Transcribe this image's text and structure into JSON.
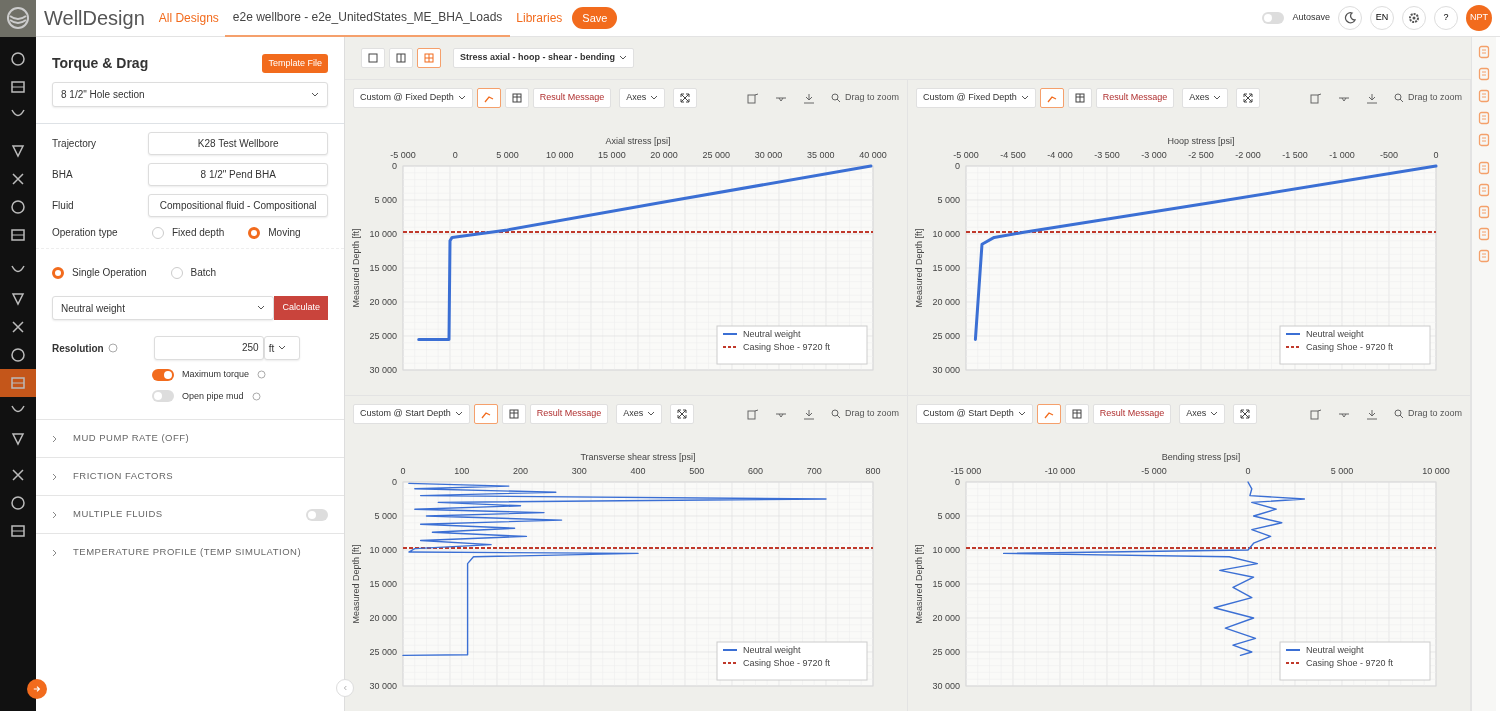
{
  "app": {
    "name": "WellDesign",
    "nav": [
      {
        "label": "All Designs",
        "kind": "link",
        "selected": false
      },
      {
        "label": "e2e wellbore - e2e_UnitedStates_ME_BHA_Loads",
        "kind": "tab",
        "selected": true
      },
      {
        "label": "Libraries",
        "kind": "link",
        "selected": false
      }
    ],
    "save": "Save",
    "autosave": {
      "label": "Autosave",
      "on": false
    },
    "language": "EN",
    "help": "?",
    "avatar": "NPT"
  },
  "sidebar": {
    "items": [
      {
        "selected": false
      },
      {
        "selected": false
      },
      {
        "selected": false
      },
      {
        "selected": false
      },
      {
        "selected": false
      },
      {
        "selected": false
      },
      {
        "selected": false
      },
      {
        "selected": false
      },
      {
        "selected": false
      },
      {
        "selected": false
      },
      {
        "selected": false
      },
      {
        "selected": true
      },
      {
        "selected": false
      },
      {
        "selected": false
      },
      {
        "selected": false
      },
      {
        "selected": false
      },
      {
        "selected": false
      }
    ]
  },
  "panel": {
    "title": "Torque & Drag",
    "template_button": "Template File",
    "section": "8 1/2\" Hole section",
    "fields": [
      {
        "label": "Trajectory",
        "value": "K28 Test Wellbore"
      },
      {
        "label": "BHA",
        "value": "8 1/2\" Pend BHA"
      },
      {
        "label": "Fluid",
        "value": "Compositional fluid - Compositional"
      }
    ],
    "operation_type": {
      "label": "Operation type",
      "options": [
        {
          "label": "Fixed depth",
          "selected": false
        },
        {
          "label": "Moving",
          "selected": true
        }
      ]
    },
    "mode": [
      {
        "label": "Single Operation",
        "selected": true
      },
      {
        "label": "Batch",
        "selected": false
      }
    ],
    "operation": "Neutral weight",
    "calculate": "Calculate",
    "resolution": {
      "label": "Resolution",
      "value": "250",
      "unit": "ft"
    },
    "toggles": [
      {
        "label": "Maximum torque",
        "on": true
      },
      {
        "label": "Open pipe mud",
        "on": false
      }
    ],
    "sections": [
      {
        "label": "MUD PUMP RATE (OFF)"
      },
      {
        "label": "FRICTION FACTORS"
      },
      {
        "label": "MULTIPLE FLUIDS",
        "on": false
      },
      {
        "label": "TEMPERATURE PROFILE (TEMP SIMULATION)"
      }
    ]
  },
  "workspace": {
    "layouts": [
      {
        "selected": false
      },
      {
        "selected": false
      },
      {
        "selected": true
      }
    ],
    "view_select": "Stress axial - hoop - shear - bending",
    "charts": [
      {
        "mode": "Custom @ Fixed Depth",
        "views": [
          {
            "selected": true
          },
          {
            "selected": false
          }
        ],
        "result": "Result Message",
        "axes": "Axes",
        "zoom": "Drag to zoom",
        "chart_data": {
          "type": "line",
          "grid": true,
          "legend": true,
          "xlabel": "Axial stress [psi]",
          "ylabel": "Measured Depth [ft]",
          "xlim": [
            -5000,
            40000
          ],
          "ylim": [
            30000,
            0
          ],
          "xticks": [
            {
              "value": -5000,
              "label": "-5 000"
            },
            {
              "value": 0,
              "label": "0"
            },
            {
              "value": 5000,
              "label": "5 000"
            },
            {
              "value": 10000,
              "label": "10 000"
            },
            {
              "value": 15000,
              "label": "15 000"
            },
            {
              "value": 20000,
              "label": "20 000"
            },
            {
              "value": 25000,
              "label": "25 000"
            },
            {
              "value": 30000,
              "label": "30 000"
            },
            {
              "value": 35000,
              "label": "35 000"
            },
            {
              "value": 40000,
              "label": "40 000"
            }
          ],
          "yticks": [
            {
              "value": 0,
              "label": "0"
            },
            {
              "value": 5000,
              "label": "5 000"
            },
            {
              "value": 10000,
              "label": "10 000"
            },
            {
              "value": 15000,
              "label": "15 000"
            },
            {
              "value": 20000,
              "label": "20 000"
            },
            {
              "value": 25000,
              "label": "25 000"
            },
            {
              "value": 30000,
              "label": "30 000"
            }
          ],
          "x": [
            -3500,
            -600,
            -500,
            -300,
            5000,
            20000,
            39800
          ],
          "series": [
            {
              "name": "Neutral weight",
              "color": "#3b6fd4",
              "values": [
                25500,
                25500,
                11000,
                10500,
                9400,
                5300,
                0
              ]
            }
          ],
          "ref_lines": [
            {
              "axis": "y",
              "value": 9720,
              "label": "Casing Shoe - 9720 ft",
              "color": "#c0392b"
            }
          ]
        }
      },
      {
        "mode": "Custom @ Fixed Depth",
        "views": [
          {
            "selected": true
          },
          {
            "selected": false
          }
        ],
        "result": "Result Message",
        "axes": "Axes",
        "zoom": "Drag to zoom",
        "chart_data": {
          "type": "line",
          "grid": true,
          "legend": true,
          "xlabel": "Hoop stress [psi]",
          "ylabel": "Measured Depth [ft]",
          "xlim": [
            -5000,
            0
          ],
          "ylim": [
            30000,
            0
          ],
          "xticks": [
            {
              "value": -5000,
              "label": "-5 000"
            },
            {
              "value": -4500,
              "label": "-4 500"
            },
            {
              "value": -4000,
              "label": "-4 000"
            },
            {
              "value": -3500,
              "label": "-3 500"
            },
            {
              "value": -3000,
              "label": "-3 000"
            },
            {
              "value": -2500,
              "label": "-2 500"
            },
            {
              "value": -2000,
              "label": "-2 000"
            },
            {
              "value": -1500,
              "label": "-1 500"
            },
            {
              "value": -1000,
              "label": "-1 000"
            },
            {
              "value": -500,
              "label": "-500"
            },
            {
              "value": 0,
              "label": "0"
            }
          ],
          "yticks": [
            {
              "value": 0,
              "label": "0"
            },
            {
              "value": 5000,
              "label": "5 000"
            },
            {
              "value": 10000,
              "label": "10 000"
            },
            {
              "value": 15000,
              "label": "15 000"
            },
            {
              "value": 20000,
              "label": "20 000"
            },
            {
              "value": 25000,
              "label": "25 000"
            },
            {
              "value": 30000,
              "label": "30 000"
            }
          ],
          "x": [
            -4900,
            -4830,
            -4700,
            -4400,
            -2400,
            0
          ],
          "series": [
            {
              "name": "Neutral weight",
              "color": "#3b6fd4",
              "values": [
                25500,
                11500,
                10500,
                9800,
                5400,
                0
              ]
            }
          ],
          "ref_lines": [
            {
              "axis": "y",
              "value": 9720,
              "label": "Casing Shoe - 9720 ft",
              "color": "#c0392b"
            }
          ]
        }
      },
      {
        "mode": "Custom @ Start Depth",
        "views": [
          {
            "selected": true
          },
          {
            "selected": false
          }
        ],
        "result": "Result Message",
        "axes": "Axes",
        "zoom": "Drag to zoom",
        "chart_data": {
          "type": "line",
          "grid": true,
          "legend": true,
          "xlabel": "Transverse shear stress [psi]",
          "ylabel": "Measured Depth [ft]",
          "xlim": [
            0,
            800
          ],
          "ylim": [
            30000,
            0
          ],
          "xticks": [
            {
              "value": 0,
              "label": "0"
            },
            {
              "value": 100,
              "label": "100"
            },
            {
              "value": 200,
              "label": "200"
            },
            {
              "value": 300,
              "label": "300"
            },
            {
              "value": 400,
              "label": "400"
            },
            {
              "value": 500,
              "label": "500"
            },
            {
              "value": 600,
              "label": "600"
            },
            {
              "value": 700,
              "label": "700"
            },
            {
              "value": 800,
              "label": "800"
            }
          ],
          "yticks": [
            {
              "value": 0,
              "label": "0"
            },
            {
              "value": 5000,
              "label": "5 000"
            },
            {
              "value": 10000,
              "label": "10 000"
            },
            {
              "value": 15000,
              "label": "15 000"
            },
            {
              "value": 20000,
              "label": "20 000"
            },
            {
              "value": 25000,
              "label": "25 000"
            },
            {
              "value": 30000,
              "label": "30 000"
            }
          ],
          "x": [
            10,
            180,
            20,
            260,
            30,
            720,
            60,
            200,
            20,
            240,
            40,
            270,
            30,
            190,
            50,
            210,
            30,
            150,
            20,
            10,
            400,
            120,
            110,
            110,
            110,
            110,
            0
          ],
          "series": [
            {
              "name": "Neutral weight",
              "color": "#3b6fd4",
              "values": [
                200,
                600,
                1000,
                1500,
                2000,
                2500,
                3000,
                3500,
                4000,
                4500,
                5000,
                5600,
                6200,
                6800,
                7400,
                8000,
                8600,
                9200,
                9800,
                10300,
                10500,
                11000,
                12000,
                18000,
                25000,
                25400,
                25500
              ]
            }
          ],
          "ref_lines": [
            {
              "axis": "y",
              "value": 9720,
              "label": "Casing Shoe - 9720 ft",
              "color": "#c0392b"
            }
          ]
        }
      },
      {
        "mode": "Custom @ Start Depth",
        "views": [
          {
            "selected": true
          },
          {
            "selected": false
          }
        ],
        "result": "Result Message",
        "axes": "Axes",
        "zoom": "Drag to zoom",
        "chart_data": {
          "type": "line",
          "grid": true,
          "legend": true,
          "xlabel": "Bending stress [psi]",
          "ylabel": "Measured Depth [ft]",
          "xlim": [
            -15000,
            10000
          ],
          "ylim": [
            30000,
            0
          ],
          "xticks": [
            {
              "value": -15000,
              "label": "-15 000"
            },
            {
              "value": -10000,
              "label": "-10 000"
            },
            {
              "value": -5000,
              "label": "-5 000"
            },
            {
              "value": 0,
              "label": "0"
            },
            {
              "value": 5000,
              "label": "5 000"
            },
            {
              "value": 10000,
              "label": "10 000"
            }
          ],
          "yticks": [
            {
              "value": 0,
              "label": "0"
            },
            {
              "value": 5000,
              "label": "5 000"
            },
            {
              "value": 10000,
              "label": "10 000"
            },
            {
              "value": 15000,
              "label": "15 000"
            },
            {
              "value": 20000,
              "label": "20 000"
            },
            {
              "value": 25000,
              "label": "25 000"
            },
            {
              "value": 30000,
              "label": "30 000"
            }
          ],
          "x": [
            0,
            200,
            100,
            3000,
            200,
            1500,
            300,
            1800,
            200,
            1200,
            300,
            0,
            -13000,
            -1000,
            500,
            -1500,
            300,
            -800,
            200,
            -1800,
            300,
            -1200,
            400,
            -800,
            200,
            -400
          ],
          "series": [
            {
              "name": "Neutral weight",
              "color": "#3b6fd4",
              "values": [
                0,
                1000,
                2000,
                2500,
                3000,
                4000,
                5000,
                6000,
                7000,
                8000,
                9000,
                10000,
                10500,
                11000,
                12000,
                13000,
                14000,
                15500,
                17000,
                18500,
                20000,
                21500,
                23000,
                24000,
                25000,
                25500
              ]
            }
          ],
          "ref_lines": [
            {
              "axis": "y",
              "value": 9720,
              "label": "Casing Shoe - 9720 ft",
              "color": "#c0392b"
            }
          ]
        }
      }
    ]
  }
}
